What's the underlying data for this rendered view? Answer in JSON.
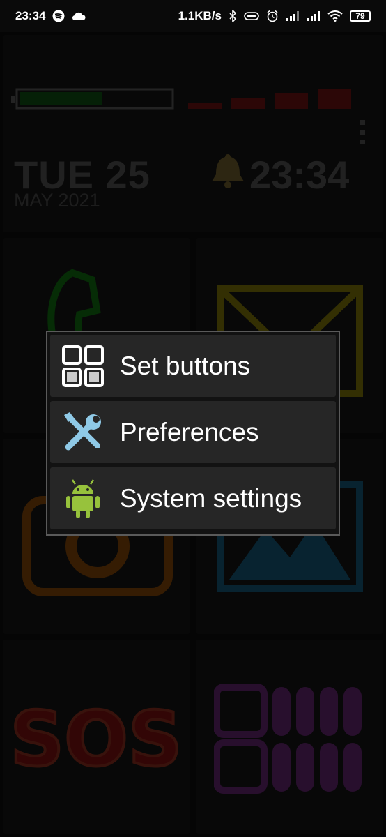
{
  "status_bar": {
    "time": "23:34",
    "net_speed": "1.1KB/s",
    "battery_level": "79",
    "icons": [
      "spotify-icon",
      "cloud-icon",
      "bluetooth-icon",
      "vibrate-icon",
      "alarm-icon",
      "signal-icon",
      "signal-icon",
      "wifi-icon",
      "battery-icon"
    ]
  },
  "clock_widget": {
    "date": "TUE 25",
    "month_year": "MAY 2021",
    "time": "23:34",
    "battery_fill_fraction": 0.55,
    "signal_bars": 4,
    "colors": {
      "battery": "#0b8a12",
      "signal": "#c61212",
      "bell": "#c9a64a",
      "text": "#8d8d8d"
    }
  },
  "tiles": [
    {
      "name": "phone",
      "icon": "phone-icon",
      "color": "#10c40f"
    },
    {
      "name": "messages",
      "icon": "envelope-icon",
      "color": "#e8d400"
    },
    {
      "name": "camera",
      "icon": "camera-icon",
      "color": "#f07a00"
    },
    {
      "name": "gallery",
      "icon": "picture-icon",
      "color": "#1a9bd8"
    },
    {
      "name": "sos",
      "label": "SOS",
      "icon": "sos-icon",
      "color": "#e01010"
    },
    {
      "name": "apps",
      "icon": "app-grid-icon",
      "color": "#b03ac8"
    }
  ],
  "menu": {
    "items": [
      {
        "label": "Set buttons",
        "icon": "grid-icon"
      },
      {
        "label": "Preferences",
        "icon": "tools-icon"
      },
      {
        "label": "System settings",
        "icon": "android-icon"
      }
    ]
  }
}
